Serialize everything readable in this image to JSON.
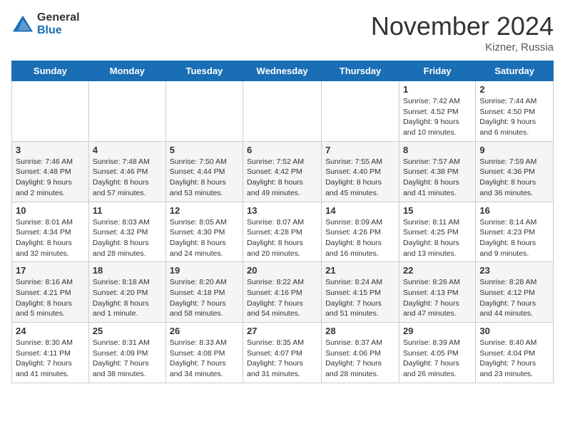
{
  "logo": {
    "general": "General",
    "blue": "Blue"
  },
  "title": {
    "month": "November 2024",
    "location": "Kizner, Russia"
  },
  "headers": [
    "Sunday",
    "Monday",
    "Tuesday",
    "Wednesday",
    "Thursday",
    "Friday",
    "Saturday"
  ],
  "rows": [
    [
      {
        "day": "",
        "info": ""
      },
      {
        "day": "",
        "info": ""
      },
      {
        "day": "",
        "info": ""
      },
      {
        "day": "",
        "info": ""
      },
      {
        "day": "",
        "info": ""
      },
      {
        "day": "1",
        "info": "Sunrise: 7:42 AM\nSunset: 4:52 PM\nDaylight: 9 hours\nand 10 minutes."
      },
      {
        "day": "2",
        "info": "Sunrise: 7:44 AM\nSunset: 4:50 PM\nDaylight: 9 hours\nand 6 minutes."
      }
    ],
    [
      {
        "day": "3",
        "info": "Sunrise: 7:46 AM\nSunset: 4:48 PM\nDaylight: 9 hours\nand 2 minutes."
      },
      {
        "day": "4",
        "info": "Sunrise: 7:48 AM\nSunset: 4:46 PM\nDaylight: 8 hours\nand 57 minutes."
      },
      {
        "day": "5",
        "info": "Sunrise: 7:50 AM\nSunset: 4:44 PM\nDaylight: 8 hours\nand 53 minutes."
      },
      {
        "day": "6",
        "info": "Sunrise: 7:52 AM\nSunset: 4:42 PM\nDaylight: 8 hours\nand 49 minutes."
      },
      {
        "day": "7",
        "info": "Sunrise: 7:55 AM\nSunset: 4:40 PM\nDaylight: 8 hours\nand 45 minutes."
      },
      {
        "day": "8",
        "info": "Sunrise: 7:57 AM\nSunset: 4:38 PM\nDaylight: 8 hours\nand 41 minutes."
      },
      {
        "day": "9",
        "info": "Sunrise: 7:59 AM\nSunset: 4:36 PM\nDaylight: 8 hours\nand 36 minutes."
      }
    ],
    [
      {
        "day": "10",
        "info": "Sunrise: 8:01 AM\nSunset: 4:34 PM\nDaylight: 8 hours\nand 32 minutes."
      },
      {
        "day": "11",
        "info": "Sunrise: 8:03 AM\nSunset: 4:32 PM\nDaylight: 8 hours\nand 28 minutes."
      },
      {
        "day": "12",
        "info": "Sunrise: 8:05 AM\nSunset: 4:30 PM\nDaylight: 8 hours\nand 24 minutes."
      },
      {
        "day": "13",
        "info": "Sunrise: 8:07 AM\nSunset: 4:28 PM\nDaylight: 8 hours\nand 20 minutes."
      },
      {
        "day": "14",
        "info": "Sunrise: 8:09 AM\nSunset: 4:26 PM\nDaylight: 8 hours\nand 16 minutes."
      },
      {
        "day": "15",
        "info": "Sunrise: 8:11 AM\nSunset: 4:25 PM\nDaylight: 8 hours\nand 13 minutes."
      },
      {
        "day": "16",
        "info": "Sunrise: 8:14 AM\nSunset: 4:23 PM\nDaylight: 8 hours\nand 9 minutes."
      }
    ],
    [
      {
        "day": "17",
        "info": "Sunrise: 8:16 AM\nSunset: 4:21 PM\nDaylight: 8 hours\nand 5 minutes."
      },
      {
        "day": "18",
        "info": "Sunrise: 8:18 AM\nSunset: 4:20 PM\nDaylight: 8 hours\nand 1 minute."
      },
      {
        "day": "19",
        "info": "Sunrise: 8:20 AM\nSunset: 4:18 PM\nDaylight: 7 hours\nand 58 minutes."
      },
      {
        "day": "20",
        "info": "Sunrise: 8:22 AM\nSunset: 4:16 PM\nDaylight: 7 hours\nand 54 minutes."
      },
      {
        "day": "21",
        "info": "Sunrise: 8:24 AM\nSunset: 4:15 PM\nDaylight: 7 hours\nand 51 minutes."
      },
      {
        "day": "22",
        "info": "Sunrise: 8:26 AM\nSunset: 4:13 PM\nDaylight: 7 hours\nand 47 minutes."
      },
      {
        "day": "23",
        "info": "Sunrise: 8:28 AM\nSunset: 4:12 PM\nDaylight: 7 hours\nand 44 minutes."
      }
    ],
    [
      {
        "day": "24",
        "info": "Sunrise: 8:30 AM\nSunset: 4:11 PM\nDaylight: 7 hours\nand 41 minutes."
      },
      {
        "day": "25",
        "info": "Sunrise: 8:31 AM\nSunset: 4:09 PM\nDaylight: 7 hours\nand 38 minutes."
      },
      {
        "day": "26",
        "info": "Sunrise: 8:33 AM\nSunset: 4:08 PM\nDaylight: 7 hours\nand 34 minutes."
      },
      {
        "day": "27",
        "info": "Sunrise: 8:35 AM\nSunset: 4:07 PM\nDaylight: 7 hours\nand 31 minutes."
      },
      {
        "day": "28",
        "info": "Sunrise: 8:37 AM\nSunset: 4:06 PM\nDaylight: 7 hours\nand 28 minutes."
      },
      {
        "day": "29",
        "info": "Sunrise: 8:39 AM\nSunset: 4:05 PM\nDaylight: 7 hours\nand 26 minutes."
      },
      {
        "day": "30",
        "info": "Sunrise: 8:40 AM\nSunset: 4:04 PM\nDaylight: 7 hours\nand 23 minutes."
      }
    ]
  ]
}
